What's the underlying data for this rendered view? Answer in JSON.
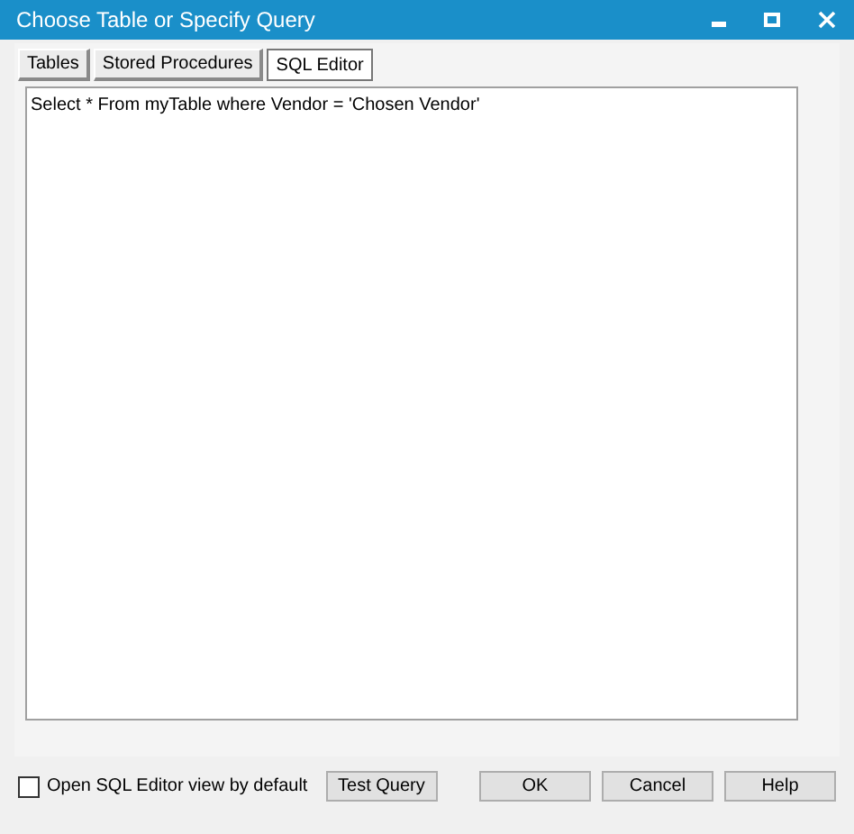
{
  "window": {
    "title": "Choose Table or Specify Query"
  },
  "tabs": [
    {
      "label": "Tables",
      "selected": false
    },
    {
      "label": "Stored Procedures",
      "selected": false
    },
    {
      "label": "SQL Editor",
      "selected": true
    }
  ],
  "editor": {
    "value": "Select * From myTable where Vendor = 'Chosen Vendor'"
  },
  "default_view_checkbox": {
    "label": "Open SQL Editor view by default",
    "checked": false
  },
  "buttons": [
    {
      "label": "Test Query",
      "kind": "left"
    },
    {
      "label": "OK",
      "kind": "right"
    },
    {
      "label": "Cancel",
      "kind": "right"
    },
    {
      "label": "Help",
      "kind": "right"
    }
  ]
}
